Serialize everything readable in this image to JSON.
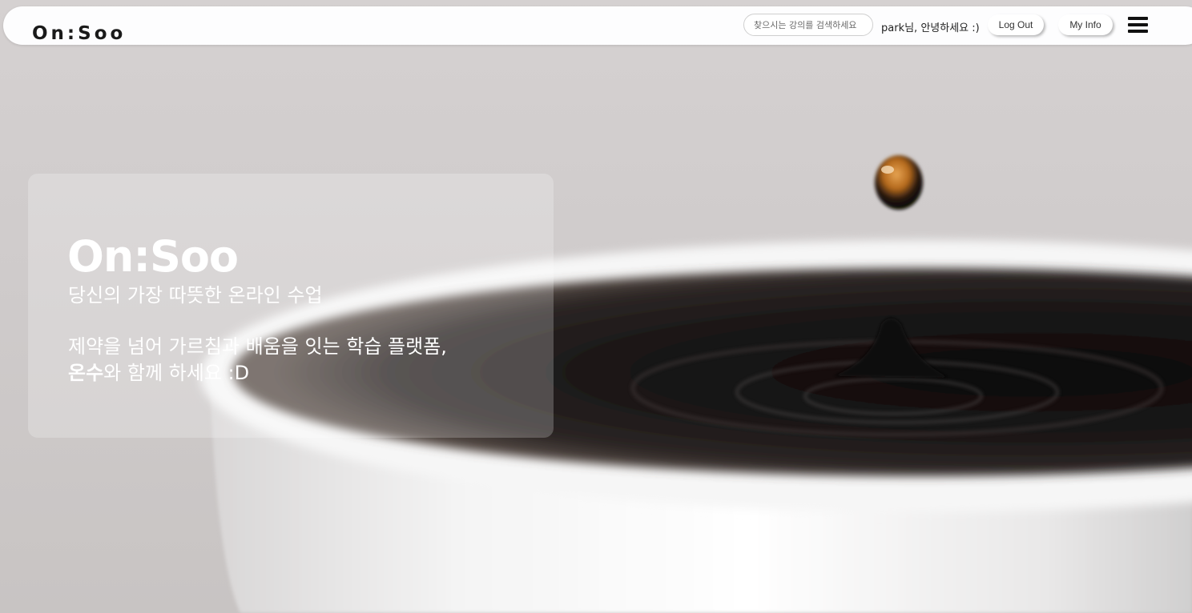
{
  "header": {
    "logo": "On:Soo",
    "search_placeholder": "찾으시는 강의를 검색하세요",
    "greeting": "park님, 안녕하세요 :)",
    "logout_label": "Log Out",
    "myinfo_label": "My Info",
    "menu_icon": "hamburger-menu-icon"
  },
  "hero": {
    "title": "On:Soo",
    "subtitle": "당신의 가장 따뜻한 온라인 수업",
    "description_line1": "제약을 넘어 가르침과 배움을 잇는 학습 플랫폼,",
    "brand_bold": "온수",
    "description_line2_rest": "와 함께 하세요 :D"
  },
  "colors": {
    "nav_background": "#fdfdfe",
    "hero_text": "#ffffff",
    "coffee": "#141010"
  }
}
